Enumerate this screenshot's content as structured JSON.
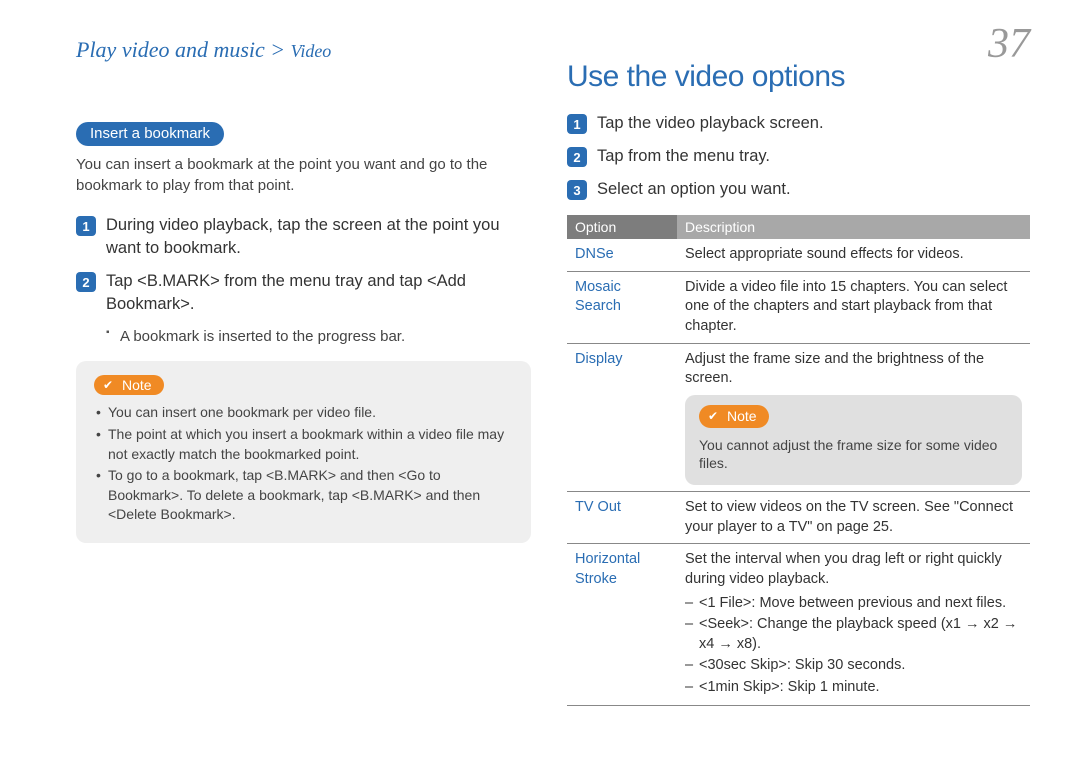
{
  "header": {
    "breadcrumb_main": "Play video and music",
    "breadcrumb_sep": " > ",
    "breadcrumb_sub": "Video",
    "page_number": "37"
  },
  "left": {
    "pill": "Insert a bookmark",
    "intro": "You can insert a bookmark at the point you want and go to the bookmark to play from that point.",
    "steps": [
      "During video playback, tap the screen at the point you want to bookmark.",
      "Tap <B.MARK> from the menu tray and tap <Add Bookmark>."
    ],
    "substep_bullet": "A bookmark is inserted to the progress bar.",
    "note_label": "Note",
    "note_items": [
      "You can insert one bookmark per video file.",
      "The point at which you insert a bookmark within a video file may not exactly match the bookmarked point.",
      "To go to a bookmark, tap <B.MARK> and then <Go to Bookmark>. To delete a bookmark, tap <B.MARK> and then <Delete Bookmark>."
    ]
  },
  "right": {
    "title": "Use the video options",
    "steps": [
      "Tap the video playback screen.",
      "Tap        from the menu tray.",
      "Select an option you want."
    ],
    "table_headers": {
      "option": "Option",
      "description": "Description"
    },
    "rows": {
      "dnse": {
        "name": "DNSe",
        "desc": "Select appropriate sound effects for videos."
      },
      "mosaic": {
        "name": "Mosaic Search",
        "desc": "Divide a video file into 15 chapters. You can select one of the chapters and start playback from that chapter."
      },
      "display": {
        "name": "Display",
        "desc": "Adjust the frame size and the brightness of the screen.",
        "note_label": "Note",
        "note_text": "You cannot adjust the frame size for some video files."
      },
      "tvout": {
        "name": "TV Out",
        "desc": "Set to view videos on the TV screen. See \"Connect your player to a TV\" on page 25."
      },
      "hstroke": {
        "name": "Horizontal Stroke",
        "intro": "Set the interval when you drag left or right quickly during video playback.",
        "items": [
          "<1 File>: Move between previous and next files.",
          "<Seek>: Change the playback speed (x1 → x2 → x4 → x8).",
          "<30sec Skip>: Skip 30 seconds.",
          "<1min Skip>: Skip 1 minute."
        ]
      }
    }
  }
}
